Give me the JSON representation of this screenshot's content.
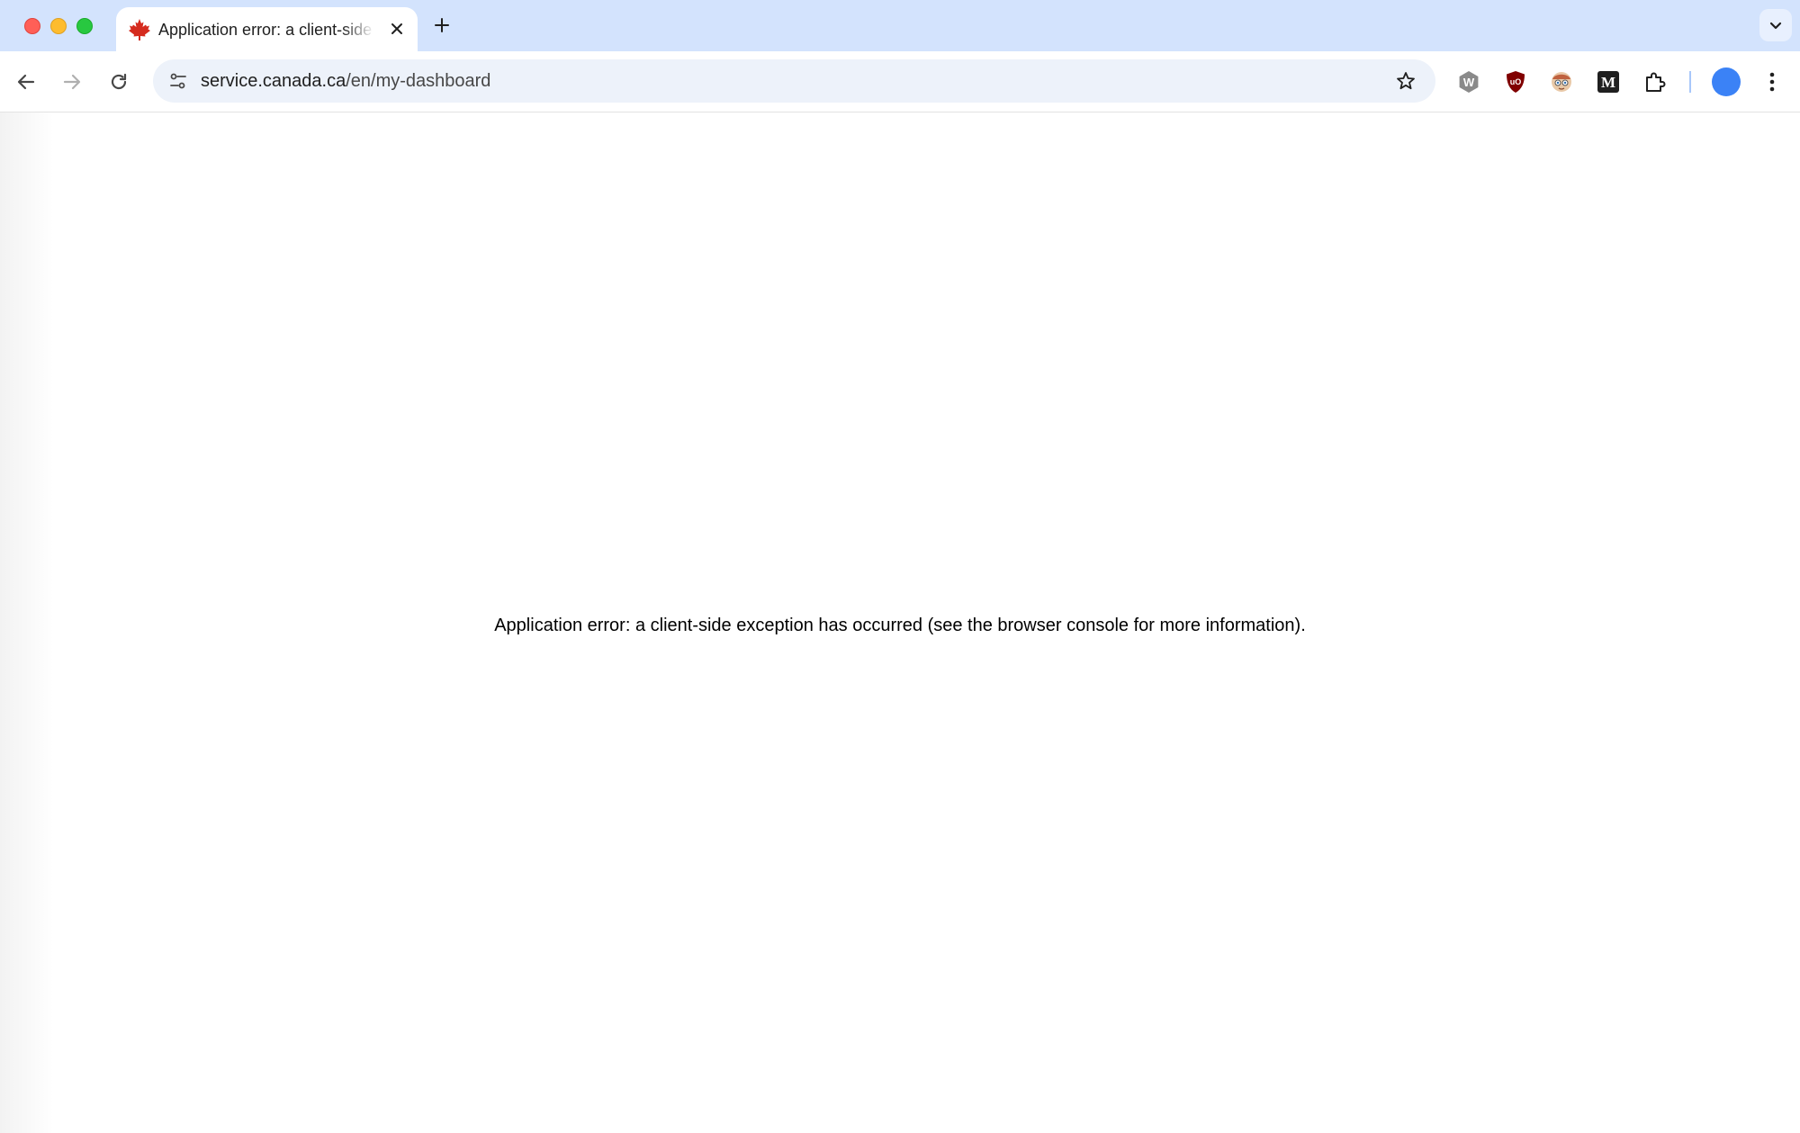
{
  "browser": {
    "tab": {
      "title": "Application error: a client-side exception has occurred (see the browser console for more information).",
      "favicon": "maple-leaf-icon"
    },
    "address_bar": {
      "host": "service.canada.ca",
      "path": "/en/my-dashboard"
    },
    "extensions": [
      {
        "name": "w-extension-icon",
        "label": "W"
      },
      {
        "name": "ublock-origin-icon",
        "label": "uO"
      },
      {
        "name": "character-extension-icon",
        "label": ""
      },
      {
        "name": "medium-extension-icon",
        "label": "M"
      },
      {
        "name": "extensions-puzzle-icon",
        "label": ""
      }
    ],
    "colors": {
      "tabstrip": "#d3e3fd",
      "omnibox": "#edf2fa",
      "avatar": "#3b82f6"
    }
  },
  "page": {
    "error_message": "Application error: a client-side exception has occurred (see the browser console for more information)."
  }
}
